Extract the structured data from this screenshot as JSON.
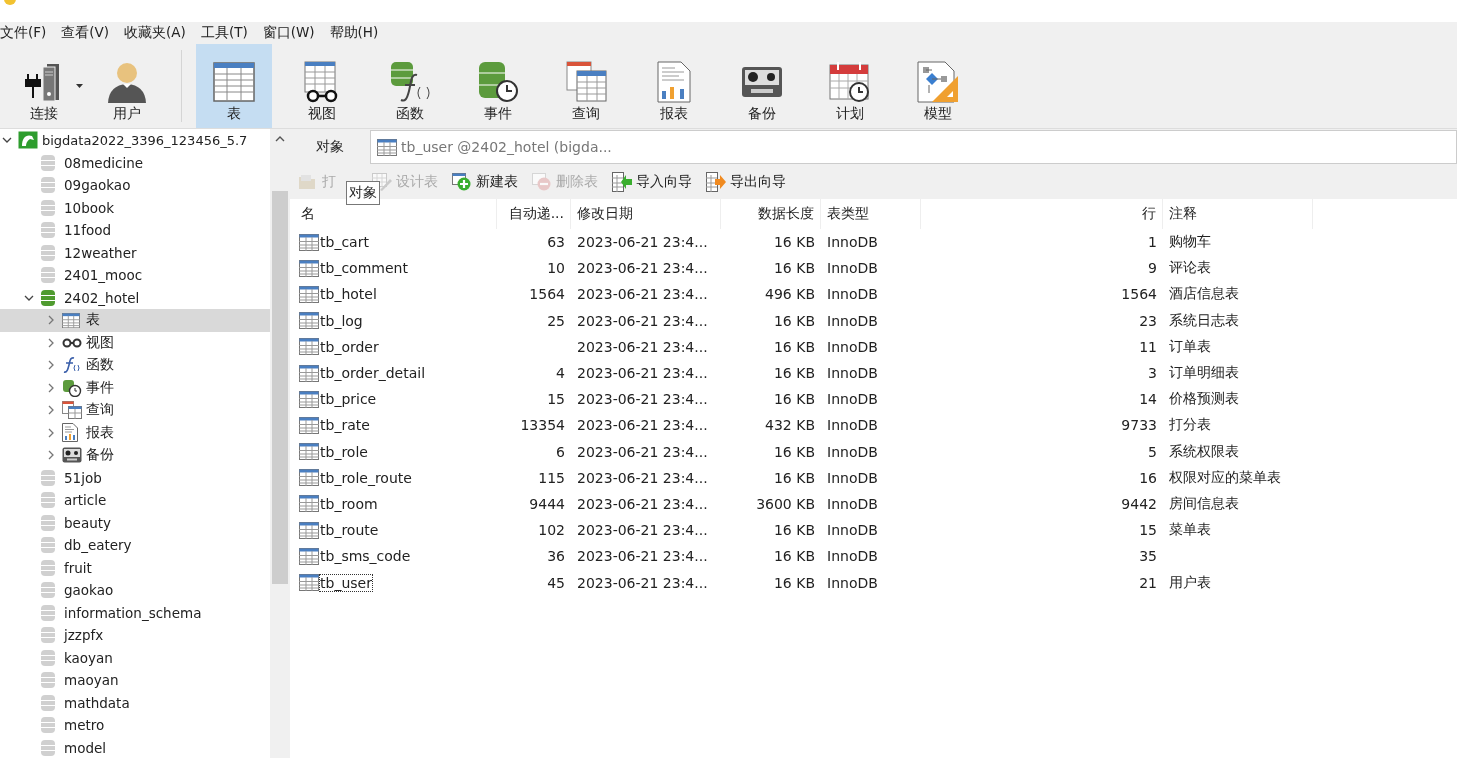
{
  "menu": [
    {
      "label": "文件(F)"
    },
    {
      "label": "查看(V)"
    },
    {
      "label": "收藏夹(A)"
    },
    {
      "label": "工具(T)"
    },
    {
      "label": "窗口(W)"
    },
    {
      "label": "帮助(H)"
    }
  ],
  "toolbar": [
    {
      "label": "连接",
      "kind": "connect",
      "selected": false,
      "dropdown": true
    },
    {
      "label": "用户",
      "kind": "user",
      "selected": false,
      "dropdown": false
    },
    {
      "label": "表",
      "kind": "table",
      "selected": true,
      "dropdown": false
    },
    {
      "label": "视图",
      "kind": "view",
      "selected": false,
      "dropdown": false
    },
    {
      "label": "函数",
      "kind": "function",
      "selected": false,
      "dropdown": false
    },
    {
      "label": "事件",
      "kind": "event",
      "selected": false,
      "dropdown": false
    },
    {
      "label": "查询",
      "kind": "query",
      "selected": false,
      "dropdown": false
    },
    {
      "label": "报表",
      "kind": "report",
      "selected": false,
      "dropdown": false
    },
    {
      "label": "备份",
      "kind": "backup",
      "selected": false,
      "dropdown": false
    },
    {
      "label": "计划",
      "kind": "schedule",
      "selected": false,
      "dropdown": false
    },
    {
      "label": "模型",
      "kind": "model",
      "selected": false,
      "dropdown": false
    }
  ],
  "tree": [
    {
      "label": "bigdata2022_3396_123456_5.7",
      "kind": "connection",
      "expanded": true,
      "selected": false,
      "children": [
        {
          "label": "08medicine",
          "kind": "database",
          "connected": false,
          "selected": false
        },
        {
          "label": "09gaokao",
          "kind": "database",
          "connected": false,
          "selected": false
        },
        {
          "label": "10book",
          "kind": "database",
          "connected": false,
          "selected": false
        },
        {
          "label": "11food",
          "kind": "database",
          "connected": false,
          "selected": false
        },
        {
          "label": "12weather",
          "kind": "database",
          "connected": false,
          "selected": false
        },
        {
          "label": "2401_mooc",
          "kind": "database",
          "connected": false,
          "selected": false
        },
        {
          "label": "2402_hotel",
          "kind": "database",
          "connected": true,
          "expanded": true,
          "selected": false,
          "children": [
            {
              "label": "表",
              "kind": "table",
              "expanded": false,
              "selected": true
            },
            {
              "label": "视图",
              "kind": "view",
              "expanded": false,
              "selected": false
            },
            {
              "label": "函数",
              "kind": "function",
              "expanded": false,
              "selected": false
            },
            {
              "label": "事件",
              "kind": "event",
              "expanded": false,
              "selected": false
            },
            {
              "label": "查询",
              "kind": "query",
              "expanded": false,
              "selected": false
            },
            {
              "label": "报表",
              "kind": "report",
              "expanded": false,
              "selected": false
            },
            {
              "label": "备份",
              "kind": "backup",
              "expanded": false,
              "selected": false
            }
          ]
        },
        {
          "label": "51job",
          "kind": "database",
          "connected": false,
          "selected": false
        },
        {
          "label": "article",
          "kind": "database",
          "connected": false,
          "selected": false
        },
        {
          "label": "beauty",
          "kind": "database",
          "connected": false,
          "selected": false
        },
        {
          "label": "db_eatery",
          "kind": "database",
          "connected": false,
          "selected": false
        },
        {
          "label": "fruit",
          "kind": "database",
          "connected": false,
          "selected": false
        },
        {
          "label": "gaokao",
          "kind": "database",
          "connected": false,
          "selected": false
        },
        {
          "label": "information_schema",
          "kind": "database",
          "connected": false,
          "selected": false
        },
        {
          "label": "jzzpfx",
          "kind": "database",
          "connected": false,
          "selected": false
        },
        {
          "label": "kaoyan",
          "kind": "database",
          "connected": false,
          "selected": false
        },
        {
          "label": "maoyan",
          "kind": "database",
          "connected": false,
          "selected": false
        },
        {
          "label": "mathdata",
          "kind": "database",
          "connected": false,
          "selected": false
        },
        {
          "label": "metro",
          "kind": "database",
          "connected": false,
          "selected": false
        },
        {
          "label": "model",
          "kind": "database",
          "connected": false,
          "selected": false
        }
      ]
    }
  ],
  "tabs": [
    {
      "label": "对象",
      "kind": "objects",
      "selected": true
    },
    {
      "label": "tb_user @2402_hotel (bigda...",
      "kind": "table",
      "selected": false
    }
  ],
  "actions": [
    {
      "label": "打",
      "kind": "open",
      "disabled": true
    },
    {
      "label": "设计表",
      "kind": "design",
      "disabled": true
    },
    {
      "label": "新建表",
      "kind": "new",
      "disabled": false
    },
    {
      "label": "删除表",
      "kind": "delete",
      "disabled": true
    },
    {
      "label": "导入向导",
      "kind": "import",
      "disabled": false
    },
    {
      "label": "导出向导",
      "kind": "export",
      "disabled": false
    }
  ],
  "tooltip": "对象",
  "table": {
    "columns": [
      "名",
      "自动递...",
      "修改日期",
      "数据长度",
      "表类型",
      "行",
      "注释"
    ],
    "rows": [
      {
        "cells": [
          "tb_cart",
          "63",
          "2023-06-21 23:4...",
          "16 KB",
          "InnoDB",
          "1",
          "购物车"
        ],
        "selected": false
      },
      {
        "cells": [
          "tb_comment",
          "10",
          "2023-06-21 23:4...",
          "16 KB",
          "InnoDB",
          "9",
          "评论表"
        ],
        "selected": false
      },
      {
        "cells": [
          "tb_hotel",
          "1564",
          "2023-06-21 23:4...",
          "496 KB",
          "InnoDB",
          "1564",
          "酒店信息表"
        ],
        "selected": false
      },
      {
        "cells": [
          "tb_log",
          "25",
          "2023-06-21 23:4...",
          "16 KB",
          "InnoDB",
          "23",
          "系统日志表"
        ],
        "selected": false
      },
      {
        "cells": [
          "tb_order",
          "",
          "2023-06-21 23:4...",
          "16 KB",
          "InnoDB",
          "11",
          "订单表"
        ],
        "selected": false
      },
      {
        "cells": [
          "tb_order_detail",
          "4",
          "2023-06-21 23:4...",
          "16 KB",
          "InnoDB",
          "3",
          "订单明细表"
        ],
        "selected": false
      },
      {
        "cells": [
          "tb_price",
          "15",
          "2023-06-21 23:4...",
          "16 KB",
          "InnoDB",
          "14",
          "价格预测表"
        ],
        "selected": false
      },
      {
        "cells": [
          "tb_rate",
          "13354",
          "2023-06-21 23:4...",
          "432 KB",
          "InnoDB",
          "9733",
          "打分表"
        ],
        "selected": false
      },
      {
        "cells": [
          "tb_role",
          "6",
          "2023-06-21 23:4...",
          "16 KB",
          "InnoDB",
          "5",
          "系统权限表"
        ],
        "selected": false
      },
      {
        "cells": [
          "tb_role_route",
          "115",
          "2023-06-21 23:4...",
          "16 KB",
          "InnoDB",
          "16",
          "权限对应的菜单表"
        ],
        "selected": false
      },
      {
        "cells": [
          "tb_room",
          "9444",
          "2023-06-21 23:4...",
          "3600 KB",
          "InnoDB",
          "9442",
          "房间信息表"
        ],
        "selected": false
      },
      {
        "cells": [
          "tb_route",
          "102",
          "2023-06-21 23:4...",
          "16 KB",
          "InnoDB",
          "15",
          "菜单表"
        ],
        "selected": false
      },
      {
        "cells": [
          "tb_sms_code",
          "36",
          "2023-06-21 23:4...",
          "16 KB",
          "InnoDB",
          "35",
          ""
        ],
        "selected": false
      },
      {
        "cells": [
          "tb_user",
          "45",
          "2023-06-21 23:4...",
          "16 KB",
          "InnoDB",
          "21",
          "用户表"
        ],
        "selected": true
      }
    ]
  }
}
